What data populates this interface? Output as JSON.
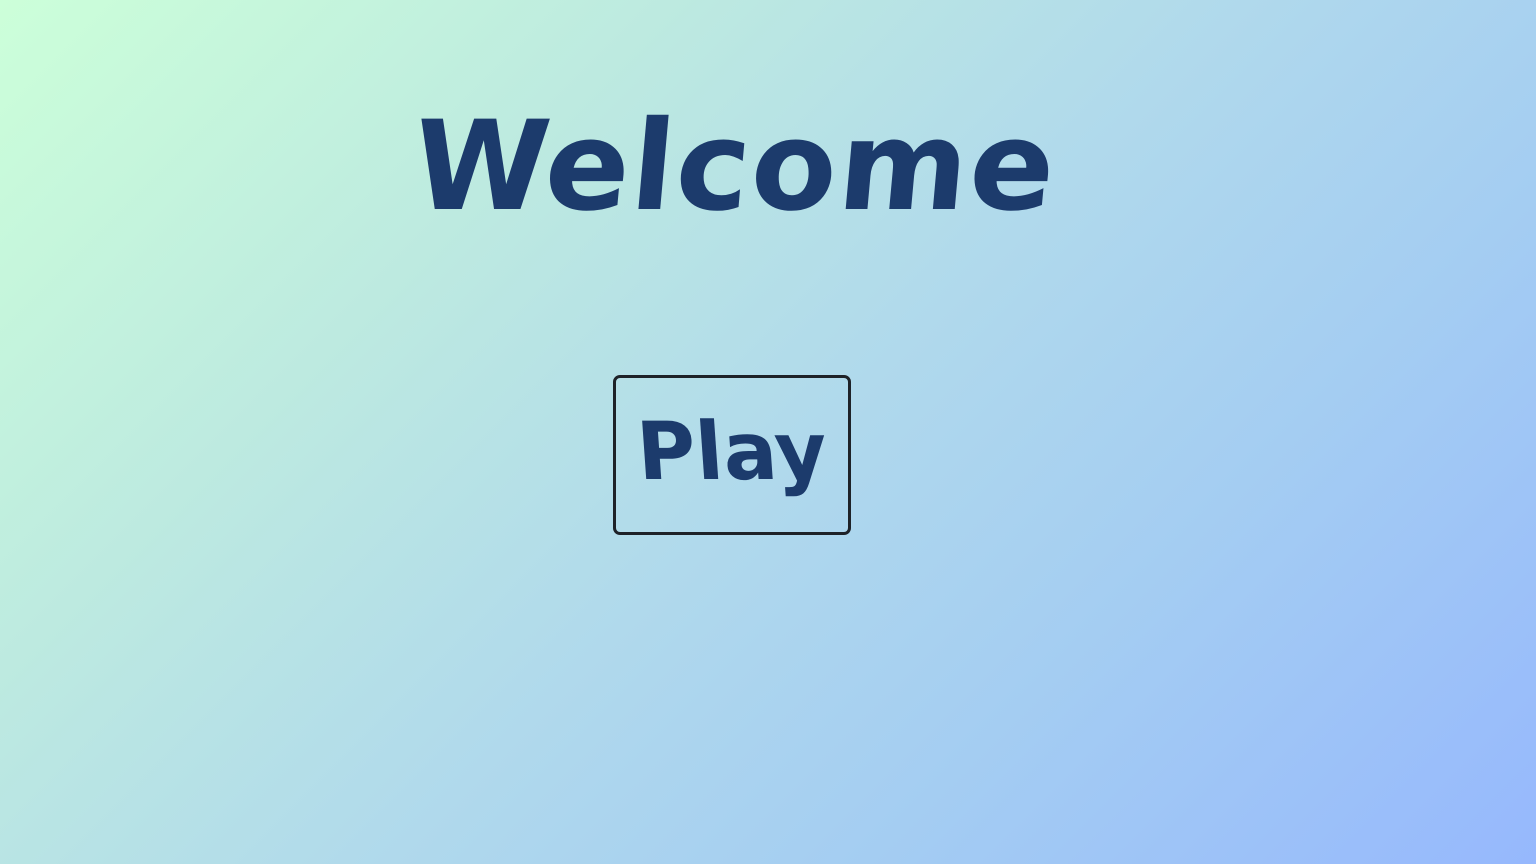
{
  "screen": {
    "title": "Welcome",
    "play_label": "Play"
  },
  "colors": {
    "text": "#1c3b6c",
    "button_border": "#1e2228",
    "gradient_start": "#ccffd9",
    "gradient_end": "#96b8fd"
  }
}
